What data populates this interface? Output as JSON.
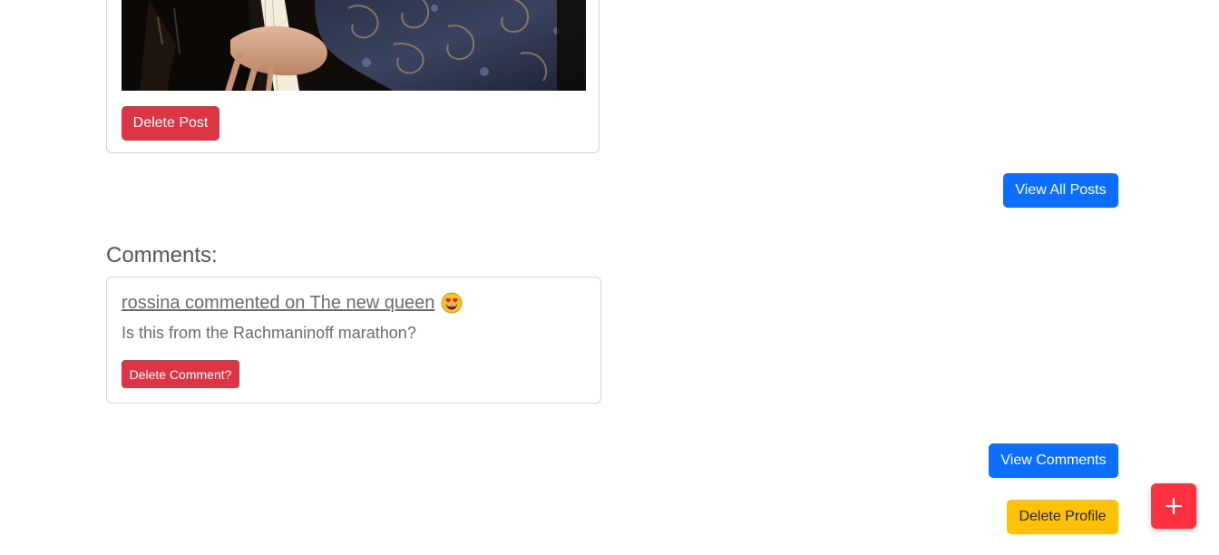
{
  "post": {
    "image_alt": "Pianist playing a grand piano",
    "delete_label": "Delete Post"
  },
  "posts_nav": {
    "view_all_label": "View All Posts"
  },
  "comments": {
    "heading": "Comments:",
    "items": [
      {
        "title": "rossina commented on The new queen",
        "emoji": "heart-eyes-emoji",
        "body": "Is this from the Rachmaninoff marathon?",
        "delete_label": "Delete Comment?"
      }
    ],
    "view_label": "View Comments"
  },
  "profile": {
    "delete_label": "Delete Profile"
  },
  "fab": {
    "icon": "plus-icon"
  },
  "colors": {
    "danger": "#dc3545",
    "primary": "#0d6efd",
    "warning": "#ffc107",
    "fab": "#ff3040"
  }
}
